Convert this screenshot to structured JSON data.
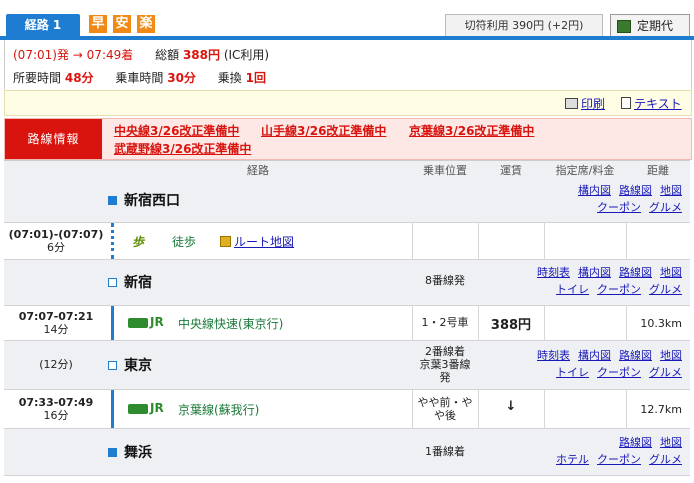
{
  "header": {
    "route_tab": "経路 1",
    "badges": [
      "早",
      "安",
      "楽"
    ],
    "fare_box": "切符利用  390円 (+2円)",
    "commuter_pass": "定期代"
  },
  "summary": {
    "dep": "(07:01)発",
    "arrow": "→",
    "arr": "07:49着",
    "total_label": "総額",
    "total_value": "388円",
    "total_note": "(IC利用)",
    "duration_label": "所要時間",
    "duration_value": "48分",
    "ride_label": "乗車時間",
    "ride_value": "30分",
    "transfer_label": "乗換",
    "transfer_value": "1回"
  },
  "tools": {
    "print": "印刷",
    "text": "テキスト"
  },
  "line_info": {
    "label": "路線情報",
    "links": [
      "中央線3/26改正準備中",
      "山手線3/26改正準備中",
      "京葉線3/26改正準備中",
      "武蔵野線3/26改正準備中"
    ]
  },
  "table_header": {
    "route": "経路",
    "position": "乗車位置",
    "fare": "運賃",
    "reserved": "指定席/料金",
    "distance": "距離"
  },
  "stations": [
    {
      "name": "新宿西口",
      "platform": "",
      "links_top": [
        "構内図",
        "路線図",
        "地図"
      ],
      "links_bottom": [
        "クーポン",
        "グルメ"
      ]
    },
    {
      "name": "新宿",
      "platform": "8番線発",
      "links_top": [
        "時刻表",
        "構内図",
        "路線図",
        "地図"
      ],
      "links_bottom": [
        "トイレ",
        "クーポン",
        "グルメ"
      ]
    },
    {
      "name": "東京",
      "time": "(12分)",
      "platform": "2番線着\n京葉3番線\n発",
      "links_top": [
        "時刻表",
        "構内図",
        "路線図",
        "地図"
      ],
      "links_bottom": [
        "トイレ",
        "クーポン",
        "グルメ"
      ]
    },
    {
      "name": "舞浜",
      "platform": "1番線着",
      "links_top": [
        "路線図",
        "地図"
      ],
      "links_bottom": [
        "ホテル",
        "クーポン",
        "グルメ"
      ]
    }
  ],
  "segments": [
    {
      "time": "(07:01)-(07:07)",
      "duration": "6分",
      "icon": "歩",
      "name": "徒歩",
      "route_map": "ルート地図"
    },
    {
      "time": "07:07-07:21",
      "duration": "14分",
      "icon": "JR",
      "name": "中央線快速(東京行)",
      "position": "1・2号車",
      "fare": "388円",
      "distance": "10.3km"
    },
    {
      "time": "07:33-07:49",
      "duration": "16分",
      "icon": "JR",
      "name": "京葉線(蘇我行)",
      "position": "やや前・や\nや後",
      "fare": "↓",
      "distance": "12.7km"
    }
  ],
  "colors": {
    "accent": "#1f7dd1",
    "alert": "#d9140e",
    "line_green": "#1a7a3a"
  }
}
